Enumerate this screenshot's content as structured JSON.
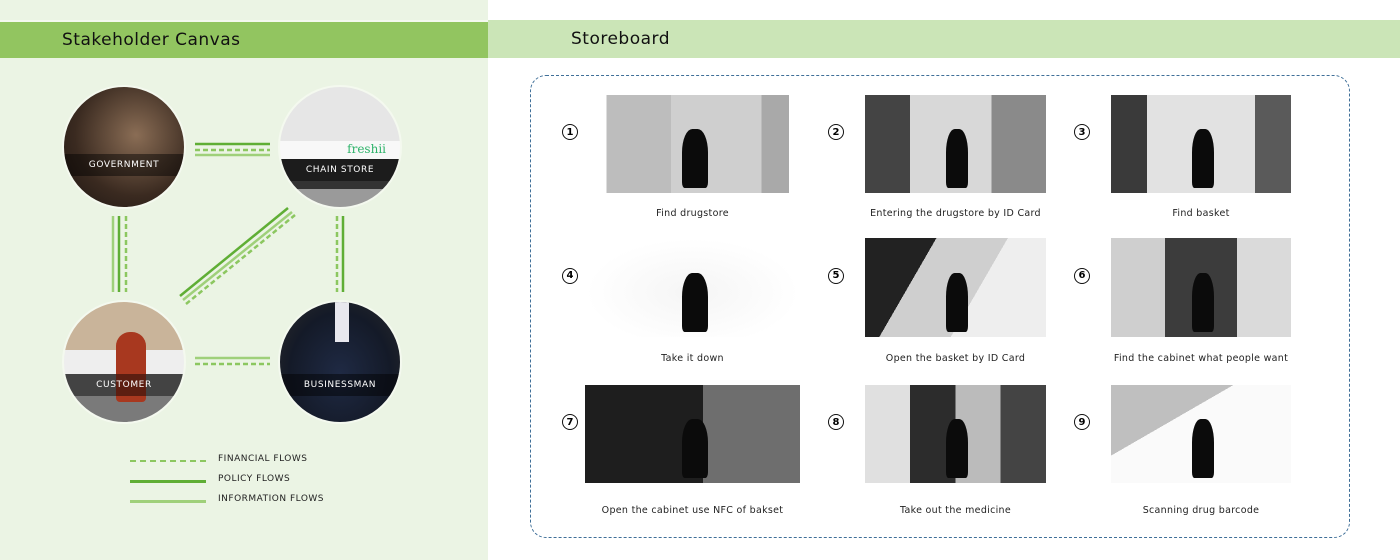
{
  "left": {
    "title": "Stakeholder Canvas",
    "nodes": [
      {
        "label": "GOVERNMENT"
      },
      {
        "label": "CHAIN STORE",
        "brand": "freshii"
      },
      {
        "label": "CUSTOMER"
      },
      {
        "label": "BUSINESSMAN"
      }
    ],
    "legend": [
      {
        "label": "FINANCIAL FLOWS",
        "style": "dashed",
        "color": "#8cc760"
      },
      {
        "label": "POLICY FLOWS",
        "style": "solid",
        "color": "#5fae35"
      },
      {
        "label": "INFORMATION FLOWS",
        "style": "solid-light",
        "color": "#9fd07a"
      }
    ]
  },
  "right": {
    "title": "Storeboard",
    "steps": [
      {
        "num": "1",
        "caption": "Find drugstore"
      },
      {
        "num": "2",
        "caption": "Entering the drugstore by ID Card"
      },
      {
        "num": "3",
        "caption": "Find  basket"
      },
      {
        "num": "4",
        "caption": "Take it down"
      },
      {
        "num": "5",
        "caption": "Open the basket by ID Card"
      },
      {
        "num": "6",
        "caption": "Find the cabinet what people want"
      },
      {
        "num": "7",
        "caption": "Open the cabinet use NFC of bakset"
      },
      {
        "num": "8",
        "caption": "Take out the medicine"
      },
      {
        "num": "9",
        "caption": "Scanning drug barcode"
      }
    ]
  },
  "colors": {
    "header_dark": "#92c560",
    "header_light": "#cbe5b7",
    "panel": "#ebf4e4",
    "frame": "#3f6f98"
  }
}
